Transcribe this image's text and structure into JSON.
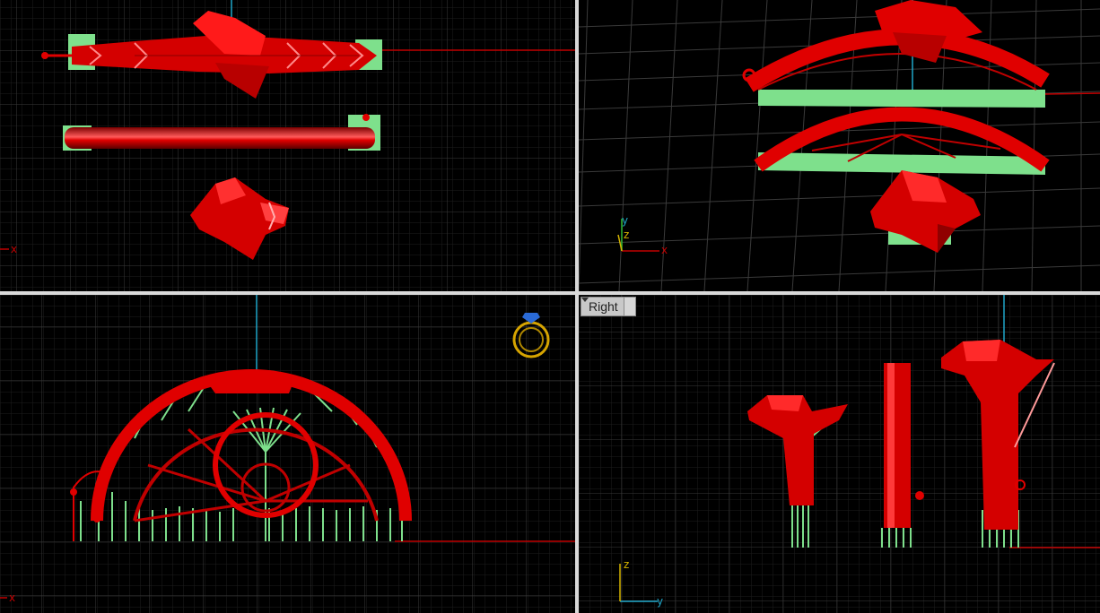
{
  "viewports": {
    "top_left": {
      "axis_x_label": "x"
    },
    "top_right": {
      "axis_x_label": "x",
      "axis_y_label": "y",
      "axis_z_label": "z"
    },
    "bottom_left": {
      "axis_x_label": "x"
    },
    "bottom_right": {
      "title": "Right",
      "axis_z_label": "z",
      "axis_y_label": "y"
    }
  },
  "colors": {
    "background": "#000000",
    "grid_minor": "#1f1f1f",
    "grid_major": "#3d3d3d",
    "model": "#e00000",
    "supports": "#7ee08c",
    "axis_red": "#c00000",
    "axis_cyan": "#1fa6c8",
    "axis_green": "#2fb82f",
    "axis_yellow": "#d6b400",
    "frame": "#d9d9d9"
  },
  "icons": {
    "dropdown": "chevron-down-icon",
    "ring": "ring-icon"
  }
}
